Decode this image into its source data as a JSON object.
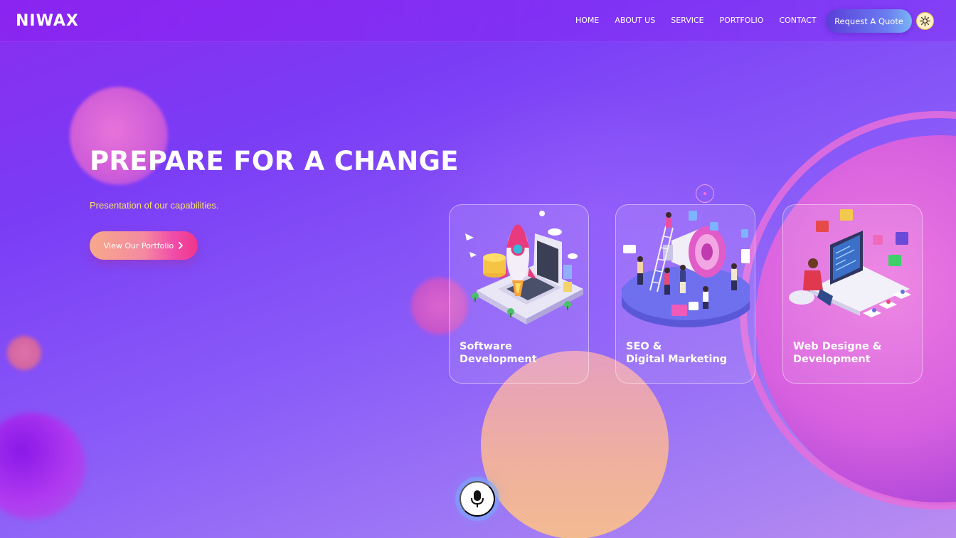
{
  "brand": {
    "logo": "NIWAX"
  },
  "nav": {
    "items": [
      {
        "label": "HOME"
      },
      {
        "label": "ABOUT US"
      },
      {
        "label": "SERVICE"
      },
      {
        "label": "PORTFOLIO"
      },
      {
        "label": "CONTACT"
      }
    ],
    "quote_button": "Request A Quote",
    "theme_toggle_icon": "sun-icon"
  },
  "hero": {
    "title": "PREPARE FOR A CHANGE",
    "subtitle": "Presentation of our capabilities.",
    "cta_label": "View Our Portfolio",
    "cta_icon": "chevron-right-icon"
  },
  "services": [
    {
      "line1": "Software",
      "line2": "Development",
      "icon": "rocket-laptop-illustration"
    },
    {
      "line1": "SEO &",
      "line2": "Digital Marketing",
      "icon": "megaphone-team-illustration"
    },
    {
      "line1": "Web Designe &",
      "line2": "Development",
      "icon": "web-developer-illustration"
    }
  ],
  "mic": {
    "icon": "microphone-icon"
  },
  "colors": {
    "accent_yellow": "#f6e26a",
    "cta_gradient_start": "#f6a98a",
    "cta_gradient_end": "#f0358a",
    "quote_gradient_start": "#5a3ed8",
    "quote_gradient_end": "#7ab4f5"
  }
}
